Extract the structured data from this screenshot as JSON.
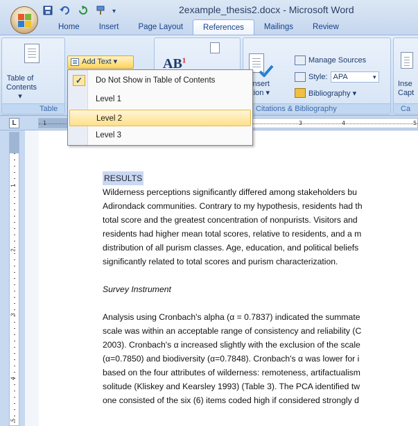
{
  "window": {
    "title": "2example_thesis2.docx - Microsoft Word"
  },
  "qat": {
    "save_icon": "save-icon",
    "undo_icon": "undo-icon",
    "redo_icon": "redo-icon",
    "customize_icon": "customize-icon"
  },
  "tabs": [
    "Home",
    "Insert",
    "Page Layout",
    "References",
    "Mailings",
    "Review"
  ],
  "ribbon": {
    "toc_label_1": "Table of",
    "toc_label_2": "Contents ▾",
    "toc_group": "Table",
    "add_text": "Add Text ▾",
    "insert_label": "nsert",
    "insert_citation_label": "ation ▾",
    "manage_sources": "Manage Sources",
    "style_label": "Style:",
    "style_value": "APA",
    "bibliography": "Bibliography ▾",
    "citations_group": "Citations & Bibliography",
    "caption_label_1": "Inse",
    "caption_label_2": "Capt",
    "caption_group": "Ca"
  },
  "dropdown": {
    "items": [
      "Do Not Show in Table of Contents",
      "Level 1",
      "Level 2",
      "Level 3"
    ],
    "checked_index": 0,
    "highlighted_index": 2
  },
  "ruler": {
    "numbers": [
      "1",
      "3",
      "4",
      "5"
    ]
  },
  "vruler": {
    "numbers": [
      "1",
      "2",
      "3",
      "4",
      "5"
    ]
  },
  "document": {
    "heading": "RESULTS",
    "p1": [
      "Wilderness perceptions significantly differed among stakeholders bu",
      "Adirondack communities. Contrary to my hypothesis, residents had th",
      "total score and the greatest concentration of nonpurists. Visitors and",
      "residents had higher mean total scores, relative to  residents, and a m",
      "distribution of all purism classes. Age, education, and political beliefs",
      "significantly related to total scores and purism characterization."
    ],
    "subheading": "Survey Instrument",
    "p2": [
      "Analysis using Cronbach's alpha (α = 0.7837) indicated the summate",
      "scale was within an acceptable range of consistency and reliability (C",
      "2003). Cronbach's α increased slightly with the exclusion of the scale",
      "(α=0.7850) and biodiversity (α=0.7848). Cronbach's α was lower for i",
      "based on the four attributes of wilderness: remoteness, artifactualism",
      "solitude (Kliskey and Kearsley 1993) (Table 3). The PCA identified tw",
      "one consisted of the six (6) items coded high if considered strongly d"
    ]
  }
}
